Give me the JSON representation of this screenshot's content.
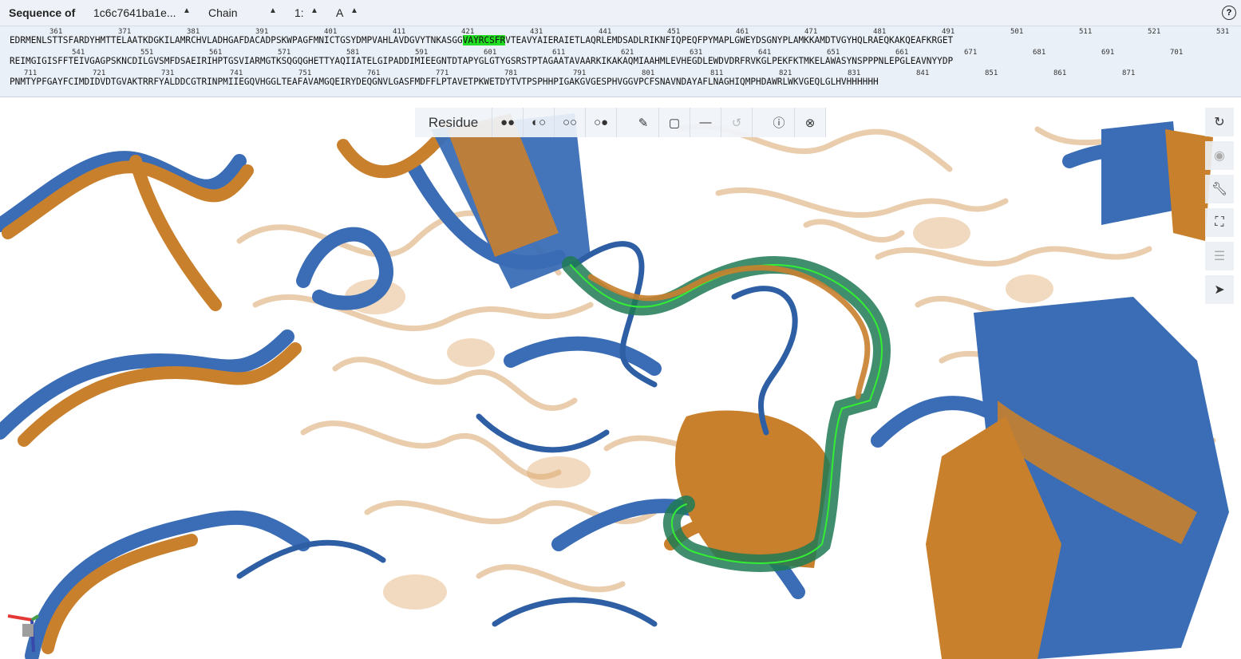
{
  "topbar": {
    "sequence_label": "Sequence of",
    "entry_value": "1c6c7641ba1e...",
    "mode_value": "Chain",
    "model_value": "1:",
    "chain_value": "A",
    "help_icon": "help-circle-icon"
  },
  "sequence": {
    "highlight_color": "#22dd22",
    "rows": [
      {
        "numbers": [
          "361",
          "371",
          "381",
          "391",
          "401",
          "411",
          "421",
          "431",
          "441",
          "451",
          "461",
          "471",
          "481",
          "491",
          "501",
          "511",
          "521",
          "531"
        ],
        "before": "EDRMENLSTTSFARDYHMTTELAATKDGKILAMRCHVLADHGAFDACADPSKWPAGFMNICTGSYDMPVAHLAVDGVYTNKASGG",
        "highlight": "VAYRCSFR",
        "after": "VTEAVYAIERAIETLAQRLEMDSADLRIKNFIQPEQFPYMAPLGWEYDSGNYPLAMKKAMDTVGYHQLRAEQKAKQEAFKRGET"
      },
      {
        "numbers": [
          "541",
          "551",
          "561",
          "571",
          "581",
          "591",
          "601",
          "611",
          "621",
          "631",
          "641",
          "651",
          "661",
          "671",
          "681",
          "691",
          "701"
        ],
        "before": "REIMGIGISFFTEIVGAGPSKNCDILGVSMFDSAEIRIHPTGSVIARMGTKSQGQGHETTYAQIIATELGIPADDIMIEEGNTDTAPYGLGTYGSRSTPTAGAATAVAARKIKAKAQMIAAHMLEVHEGDLEWDVDRFRVKGLPEKFKTMKELAWASYNSPPPNLEPGLEAVNYYDP",
        "highlight": "",
        "after": ""
      },
      {
        "numbers": [
          "711",
          "721",
          "731",
          "741",
          "751",
          "761",
          "771",
          "781",
          "791",
          "801",
          "811",
          "821",
          "831",
          "841",
          "851",
          "861",
          "871"
        ],
        "before": "PNMTYPFGAYFCIMDIDVDTGVAKTRRFYALDDCGTRINPMIIEGQVHGGLTEAFAVAMGQEIRYDEQGNVLGASFMDFFLPTAVETPKWETDYTVTPSPHHPIGAKGVGESPHVGGVPCFSNAVNDAYAFLNAGHIQMPHDAWRLWKVGEQLGLHVHHHHHH",
        "highlight": "",
        "after": ""
      }
    ]
  },
  "toolbar": {
    "selection_mode": "Residue",
    "buttons": [
      "union-icon",
      "subtract-icon",
      "intersect-icon",
      "set-icon",
      "brush-icon",
      "cube-icon",
      "minus-icon",
      "undo-icon",
      "help-icon",
      "close-icon"
    ]
  },
  "right_tools": [
    "reset-camera-icon",
    "screenshot-icon",
    "wrench-icon",
    "fullscreen-icon",
    "settings-sliders-icon",
    "selection-cursor-icon"
  ],
  "colors": {
    "structure_blue": "#3a6db5",
    "structure_orange": "#c9802d",
    "selection_green": "#33ee33",
    "panel_bg": "#eaf0f8"
  }
}
